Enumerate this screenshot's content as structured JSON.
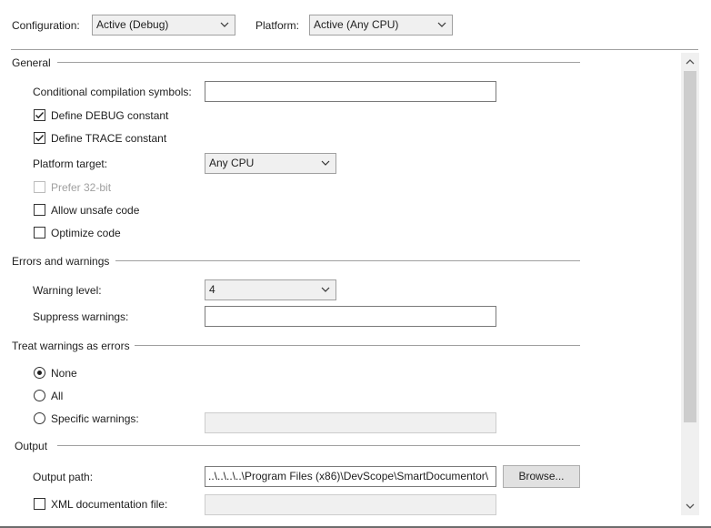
{
  "header": {
    "configuration_label": "Configuration:",
    "configuration_value": "Active (Debug)",
    "platform_label": "Platform:",
    "platform_value": "Active (Any CPU)"
  },
  "general": {
    "title": "General",
    "conditional_symbols_label": "Conditional compilation symbols:",
    "conditional_symbols_value": "",
    "define_debug_label": "Define DEBUG constant",
    "define_debug_checked": true,
    "define_trace_label": "Define TRACE constant",
    "define_trace_checked": true,
    "platform_target_label": "Platform target:",
    "platform_target_value": "Any CPU",
    "prefer32_label": "Prefer 32-bit",
    "prefer32_checked": false,
    "allow_unsafe_label": "Allow unsafe code",
    "allow_unsafe_checked": false,
    "optimize_label": "Optimize code",
    "optimize_checked": false
  },
  "errors": {
    "title": "Errors and warnings",
    "warning_level_label": "Warning level:",
    "warning_level_value": "4",
    "suppress_label": "Suppress warnings:",
    "suppress_value": ""
  },
  "treat": {
    "title": "Treat warnings as errors",
    "options": [
      {
        "label": "None",
        "selected": true
      },
      {
        "label": "All",
        "selected": false
      },
      {
        "label": "Specific warnings:",
        "selected": false
      }
    ],
    "specific_value": ""
  },
  "output": {
    "title": "Output",
    "path_label": "Output path:",
    "path_value": "..\\..\\..\\..\\Program Files (x86)\\DevScope\\SmartDocumentor\\",
    "browse_label": "Browse...",
    "xml_doc_label": "XML documentation file:",
    "xml_doc_checked": false,
    "xml_doc_value": ""
  },
  "colors": {
    "border": "#a0a0a0",
    "background": "#ffffff",
    "combo_background": "#f0f0f0",
    "disabled_text": "#a0a0a0"
  }
}
